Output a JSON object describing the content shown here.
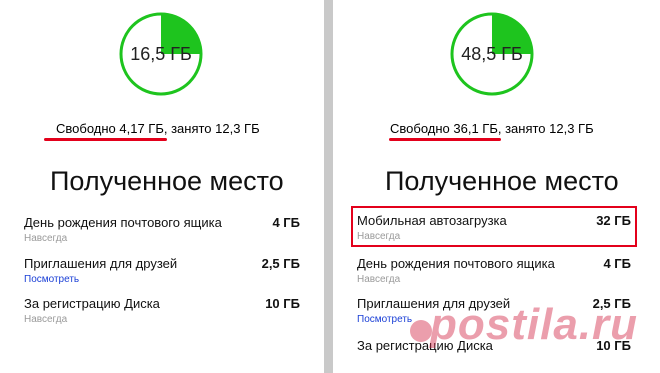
{
  "colors": {
    "donut_fill": "#1ec41e",
    "donut_ring": "#1ec41e",
    "underline": "#e3001b",
    "link": "#1a3fd6",
    "highlight": "#e3001b"
  },
  "left": {
    "donut": {
      "value": "16,5 ГБ",
      "used_fraction": 0.25
    },
    "storage": {
      "free": "Свободно 4,17 ГБ",
      "used": ", занято 12,3 ГБ"
    },
    "title": "Полученное место",
    "items": [
      {
        "name": "День рождения почтового ящика",
        "size": "4 ГБ",
        "sub": "Навсегда",
        "sub_is_link": false
      },
      {
        "name": "Приглашения для друзей",
        "size": "2,5 ГБ",
        "sub": "Посмотреть",
        "sub_is_link": true
      },
      {
        "name": "За регистрацию Диска",
        "size": "10 ГБ",
        "sub": "Навсегда",
        "sub_is_link": false
      }
    ]
  },
  "right": {
    "donut": {
      "value": "48,5 ГБ",
      "used_fraction": 0.25
    },
    "storage": {
      "free": "Свободно 36,1 ГБ",
      "used": ", занято 12,3 ГБ"
    },
    "title": "Полученное место",
    "items": [
      {
        "name": "Мобильная автозагрузка",
        "size": "32 ГБ",
        "sub": "Навсегда",
        "sub_is_link": false,
        "highlighted": true
      },
      {
        "name": "День рождения почтового ящика",
        "size": "4 ГБ",
        "sub": "Навсегда",
        "sub_is_link": false
      },
      {
        "name": "Приглашения для друзей",
        "size": "2,5 ГБ",
        "sub": "Посмотреть",
        "sub_is_link": true
      },
      {
        "name": "За регистрацию Диска",
        "size": "10 ГБ",
        "sub": "",
        "sub_is_link": false
      }
    ]
  },
  "watermark": "postila.ru"
}
